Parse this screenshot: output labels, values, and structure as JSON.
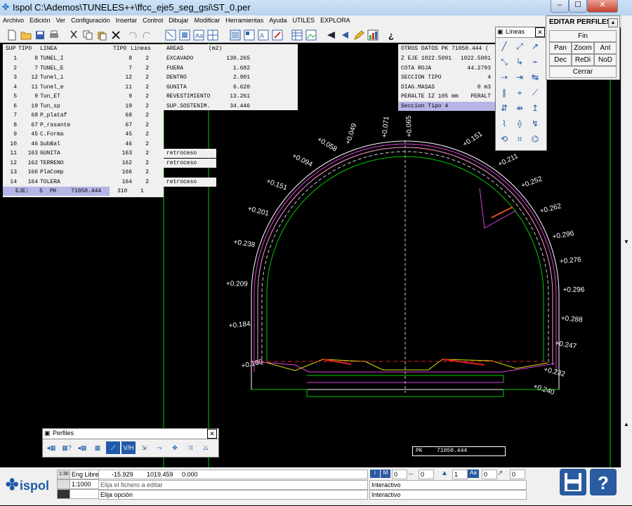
{
  "window": {
    "title": "Ispol  C:\\Ademos\\TUNELES++\\ffcc_eje5_seg_gsi\\ST_0.per",
    "minimize": "‒",
    "maximize": "☐",
    "close": "✕"
  },
  "menu": [
    "Archivo",
    "Edición",
    "Ver",
    "Configuración",
    "Insertar",
    "Control",
    "Dibujar",
    "Modificar",
    "Herramientas",
    "Ayuda",
    "UTILES",
    "EXPLORA"
  ],
  "lines_table": {
    "headers": [
      "SUP",
      "TIPO",
      "LINEA",
      "TIPO",
      "Lineas"
    ],
    "rows": [
      {
        "sup": "1",
        "tipo": "8",
        "linea": "TUNEL_I",
        "tipo2": "8",
        "lineas": "2",
        "note": ""
      },
      {
        "sup": "2",
        "tipo": "7",
        "linea": "TUNEL_E",
        "tipo2": "7",
        "lineas": "2",
        "note": ""
      },
      {
        "sup": "3",
        "tipo": "12",
        "linea": "Tunel_i",
        "tipo2": "12",
        "lineas": "2",
        "note": ""
      },
      {
        "sup": "4",
        "tipo": "11",
        "linea": "Tunel_e",
        "tipo2": "11",
        "lineas": "2",
        "note": ""
      },
      {
        "sup": "5",
        "tipo": "9",
        "linea": "Tun_ET",
        "tipo2": "9",
        "lineas": "2",
        "note": ""
      },
      {
        "sup": "6",
        "tipo": "19",
        "linea": "Tun_sp",
        "tipo2": "19",
        "lineas": "2",
        "note": ""
      },
      {
        "sup": "7",
        "tipo": "68",
        "linea": "P_plataf",
        "tipo2": "68",
        "lineas": "2",
        "note": ""
      },
      {
        "sup": "8",
        "tipo": "67",
        "linea": "P_rasante",
        "tipo2": "67",
        "lineas": "2",
        "note": ""
      },
      {
        "sup": "9",
        "tipo": "45",
        "linea": "C.Forma",
        "tipo2": "45",
        "lineas": "2",
        "note": ""
      },
      {
        "sup": "10",
        "tipo": "46",
        "linea": "SubBal",
        "tipo2": "46",
        "lineas": "2",
        "note": ""
      },
      {
        "sup": "11",
        "tipo": "163",
        "linea": "GUNITA",
        "tipo2": "163",
        "lineas": "2",
        "note": "retroceso"
      },
      {
        "sup": "12",
        "tipo": "162",
        "linea": "TERRENO",
        "tipo2": "162",
        "lineas": "2",
        "note": "retroceso"
      },
      {
        "sup": "13",
        "tipo": "166",
        "linea": "PlaComp",
        "tipo2": "166",
        "lineas": "2",
        "note": ""
      },
      {
        "sup": "14",
        "tipo": "164",
        "linea": "TOLERA",
        "tipo2": "164",
        "lineas": "2",
        "note": "retroceso"
      }
    ],
    "footer": {
      "eje": "EJE:",
      "eje_val": "5",
      "pk": "PK",
      "pk_val": "71050.444",
      "tipo": "310",
      "lineas": "1"
    }
  },
  "areas_table": {
    "header": "AREAS",
    "unit": "(m2)",
    "rows": [
      {
        "label": "EXCAVADO",
        "value": "130.265"
      },
      {
        "label": "FUERA",
        "value": "1.682"
      },
      {
        "label": "DENTRO",
        "value": "2.901"
      },
      {
        "label": "GUNITA",
        "value": "6.620"
      },
      {
        "label": "REVESTIMIENTO",
        "value": "13.261"
      },
      {
        "label": "SUP.SOSTENIM.",
        "value": "34.446"
      }
    ]
  },
  "otros_datos": {
    "header": "OTROS DATOS   PK  71050.444  (",
    "rows": [
      {
        "label": "Z EJE 1022.5091",
        "value": "1022.5091"
      },
      {
        "label": "COTA ROJA",
        "value": "44.2793"
      },
      {
        "label": "SECCION TIPO",
        "value": "4"
      },
      {
        "label": "DIAG.MASAS",
        "value": "0 m3"
      },
      {
        "label": "PERALTE IZ 105 mm",
        "value": "PERALT"
      }
    ],
    "footer": "Seccion Tipo 4"
  },
  "lineas_palette": {
    "title": "Líneas",
    "close": "✕"
  },
  "edit_panel": {
    "title": "EDITAR PERFILES",
    "fin": "Fin",
    "pan": "Pan",
    "zoom": "Zoom",
    "ant": "Ant",
    "dec": "Dec",
    "redi": "ReDi",
    "nod": "NoD",
    "cerrar": "Cerrar"
  },
  "perfiles_palette": {
    "title": "Perfiles",
    "close": "✕"
  },
  "pk_box": {
    "label": "PK",
    "value": "71050.444"
  },
  "cad_labels": [
    {
      "text": "+0.071",
      "ang": 96
    },
    {
      "text": "+0.065",
      "ang": 88
    },
    {
      "text": "+0.049",
      "ang": 108
    },
    {
      "text": "+0.058",
      "ang": 118
    },
    {
      "text": "+0.094",
      "ang": 128
    },
    {
      "text": "+0.151",
      "ang": 140
    },
    {
      "text": "+0.201",
      "ang": 151
    },
    {
      "text": "+0.238",
      "ang": 163
    },
    {
      "text": "+0.209",
      "ang": 177
    },
    {
      "text": "+0.184",
      "ang": 191
    },
    {
      "text": "+0.160",
      "ang": 205
    },
    {
      "text": "+0.151",
      "ang": 66
    },
    {
      "text": "+0.211",
      "ang": 52
    },
    {
      "text": "+0.252",
      "ang": 41
    },
    {
      "text": "+0.262",
      "ang": 30
    },
    {
      "text": "+0.296",
      "ang": 20
    },
    {
      "text": "+0.276",
      "ang": 11
    },
    {
      "text": "+0.296",
      "ang": 1
    },
    {
      "text": "+0.288",
      "ang": -9
    },
    {
      "text": "+0.247",
      "ang": -18
    },
    {
      "text": "+0.232",
      "ang": -28
    },
    {
      "text": "+0.240",
      "ang": -35
    }
  ],
  "status": {
    "scale_icon": "1:30",
    "eng_libre": "Eng Libre",
    "coord_x": "-15.929",
    "coord_y": "1019.459",
    "coord_z": "0.000",
    "scale": "1:1000",
    "edit_file": "Elija el fichero a editar",
    "option": "Elija opción",
    "mode1": "Interactivo",
    "mode2": "Interactivo",
    "n1": "0",
    "n2": "0",
    "n3": "1",
    "n4": "0",
    "n5": "0",
    "logo": "ispol"
  },
  "colors": {
    "green": "#00c800",
    "magenta": "#e040e0",
    "yellow": "#e0e000",
    "red": "#e02020",
    "white": "#ffffff",
    "pink": "#ff9ad0",
    "dashed": "#c8c8c8"
  }
}
